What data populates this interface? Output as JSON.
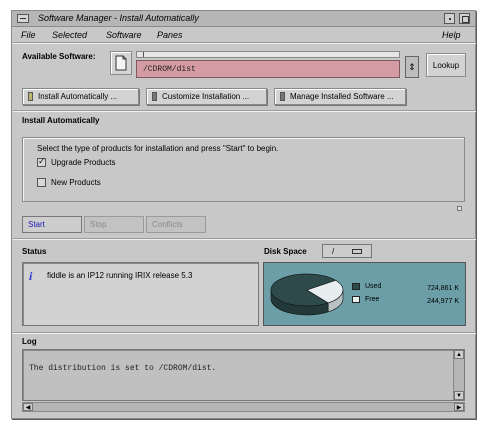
{
  "window": {
    "title": "Software Manager - Install Automatically"
  },
  "menubar": {
    "items": [
      "File",
      "Selected",
      "Software",
      "Panes",
      "Help"
    ]
  },
  "available_software": {
    "label": "Available Software:",
    "path": "/CDROM/dist",
    "lookup_label": "Lookup"
  },
  "modes": [
    {
      "label": "Install Automatically ..."
    },
    {
      "label": "Customize Installation ..."
    },
    {
      "label": "Manage Installed Software ..."
    }
  ],
  "install": {
    "heading": "Install Automatically",
    "instructions": "Select the type of products for installation and press \"Start\" to begin.",
    "options": [
      {
        "label": "Upgrade Products",
        "checked": true
      },
      {
        "label": "New Products",
        "checked": false
      }
    ]
  },
  "actions": {
    "start": "Start",
    "stop": "Stop",
    "conflicts": "Conflicts"
  },
  "status": {
    "heading": "Status",
    "icon": "info-icon",
    "message": "fiddle is an IP12 running IRIX release  5.3"
  },
  "disk_space": {
    "heading": "Disk Space",
    "toggle_label": "/",
    "used_label": "Used",
    "used_value": "724,861 K",
    "free_label": "Free",
    "free_value": "244,977 K",
    "used_fraction": 0.747,
    "used_color": "#2f4a4a",
    "free_color": "#e8eef0"
  },
  "log": {
    "heading": "Log",
    "text": "The distribution is set to /CDROM/dist."
  }
}
